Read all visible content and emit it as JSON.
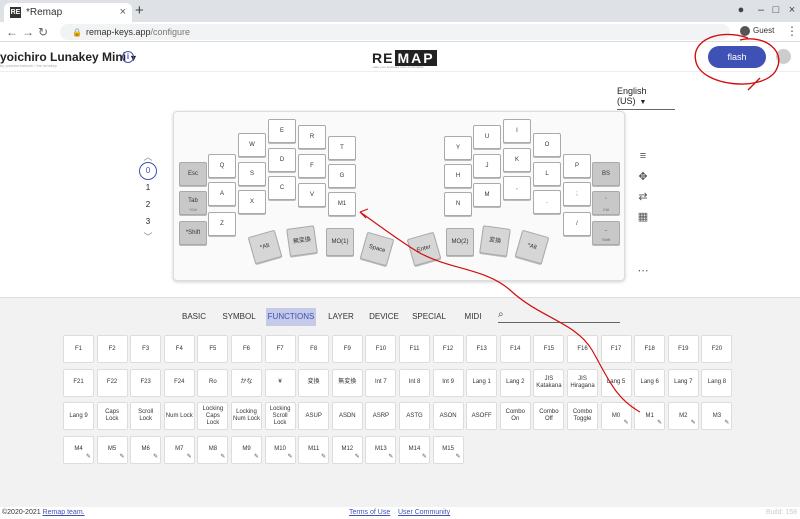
{
  "browser": {
    "tab_title": "*Remap",
    "tab_favicon": "RE",
    "url_host": "remap-keys.app",
    "url_path": "/configure",
    "profile": "Guest"
  },
  "header": {
    "keyboard_name": "yoichiro Lunakey Mini",
    "keyboard_sub": "by yoichiro.tabuchi / the lunakey",
    "logo_a": "RE",
    "logo_b": "MAP",
    "logo_sub": "make your keyboard more comfortable",
    "flash_label": "flash",
    "accent": "#3f51b5"
  },
  "language": "English (US)",
  "layers": [
    "0",
    "1",
    "2",
    "3"
  ],
  "keys": {
    "k_e": "E",
    "k_r": "R",
    "k_w": "W",
    "k_d": "D",
    "k_f": "F",
    "k_t": "T",
    "k_q": "Q",
    "k_s": "S",
    "k_g": "G",
    "k_esc": "Esc",
    "k_a": "A",
    "k_c": "C",
    "k_v": "V",
    "k_m1": "M1",
    "k_x": "X",
    "k_tab": "Tab",
    "k_tab_sub": "*Ctrl",
    "k_z": "Z",
    "k_shift": "*Shift",
    "k_lalt": "*Alt",
    "k_muhenkan": "無変換",
    "k_mo1": "MO(1)",
    "k_space": "Space",
    "k_enter": "Enter",
    "k_mo2": "MO(2)",
    "k_henkan": "変換",
    "k_ralt": "*Alt",
    "k_i": "I",
    "k_u": "U",
    "k_o": "O",
    "k_y": "Y",
    "k_j": "J",
    "k_k": "K",
    "k_p": "P",
    "k_h": "H",
    "k_l": "L",
    "k_bs": "BS",
    "k_comma": ",",
    "k_n": "N",
    "k_m": "M",
    "k_dot": ".",
    "k_semi": ";",
    "k_slash": "/",
    "k_quote": "'",
    "k_quote_sub": "Ctrl",
    "k_bar": "-",
    "k_rshift_sub": "Shift"
  },
  "categories": [
    "BASIC",
    "SYMBOL",
    "FUNCTIONS",
    "LAYER",
    "DEVICE",
    "SPECIAL",
    "MIDI"
  ],
  "active_category": "FUNCTIONS",
  "keycodes": [
    "F1",
    "F2",
    "F3",
    "F4",
    "F5",
    "F6",
    "F7",
    "F8",
    "F9",
    "F10",
    "F11",
    "F12",
    "F13",
    "F14",
    "F15",
    "F16",
    "F17",
    "F18",
    "F19",
    "F20",
    "F21",
    "F22",
    "F23",
    "F24",
    "Ro",
    "かな",
    "¥",
    "変換",
    "無変換",
    "Int 7",
    "Int 8",
    "Int 9",
    "Lang 1",
    "Lang 2",
    "JIS Katakana",
    "JIS Hiragana",
    "Lang 5",
    "Lang 6",
    "Lang 7",
    "Lang 8",
    "Lang 9",
    "Caps Lock",
    "Scroll Lock",
    "Num Lock",
    "Locking Caps Lock",
    "Locking Num Lock",
    "Locking Scroll Lock",
    "ASUP",
    "ASDN",
    "ASRP",
    "ASTG",
    "ASON",
    "ASOFF",
    "Combo On",
    "Combo Off",
    "Combo Toggle",
    "M0",
    "M1",
    "M2",
    "M3",
    "M4",
    "M5",
    "M6",
    "M7",
    "M8",
    "M9",
    "M10",
    "M11",
    "M12",
    "M13",
    "M14",
    "M15"
  ],
  "footer": {
    "copyright": "©2020-2021 ",
    "team": "Remap team.",
    "terms": "Terms of Use",
    "community": "User Community",
    "build": "Build: 158"
  }
}
